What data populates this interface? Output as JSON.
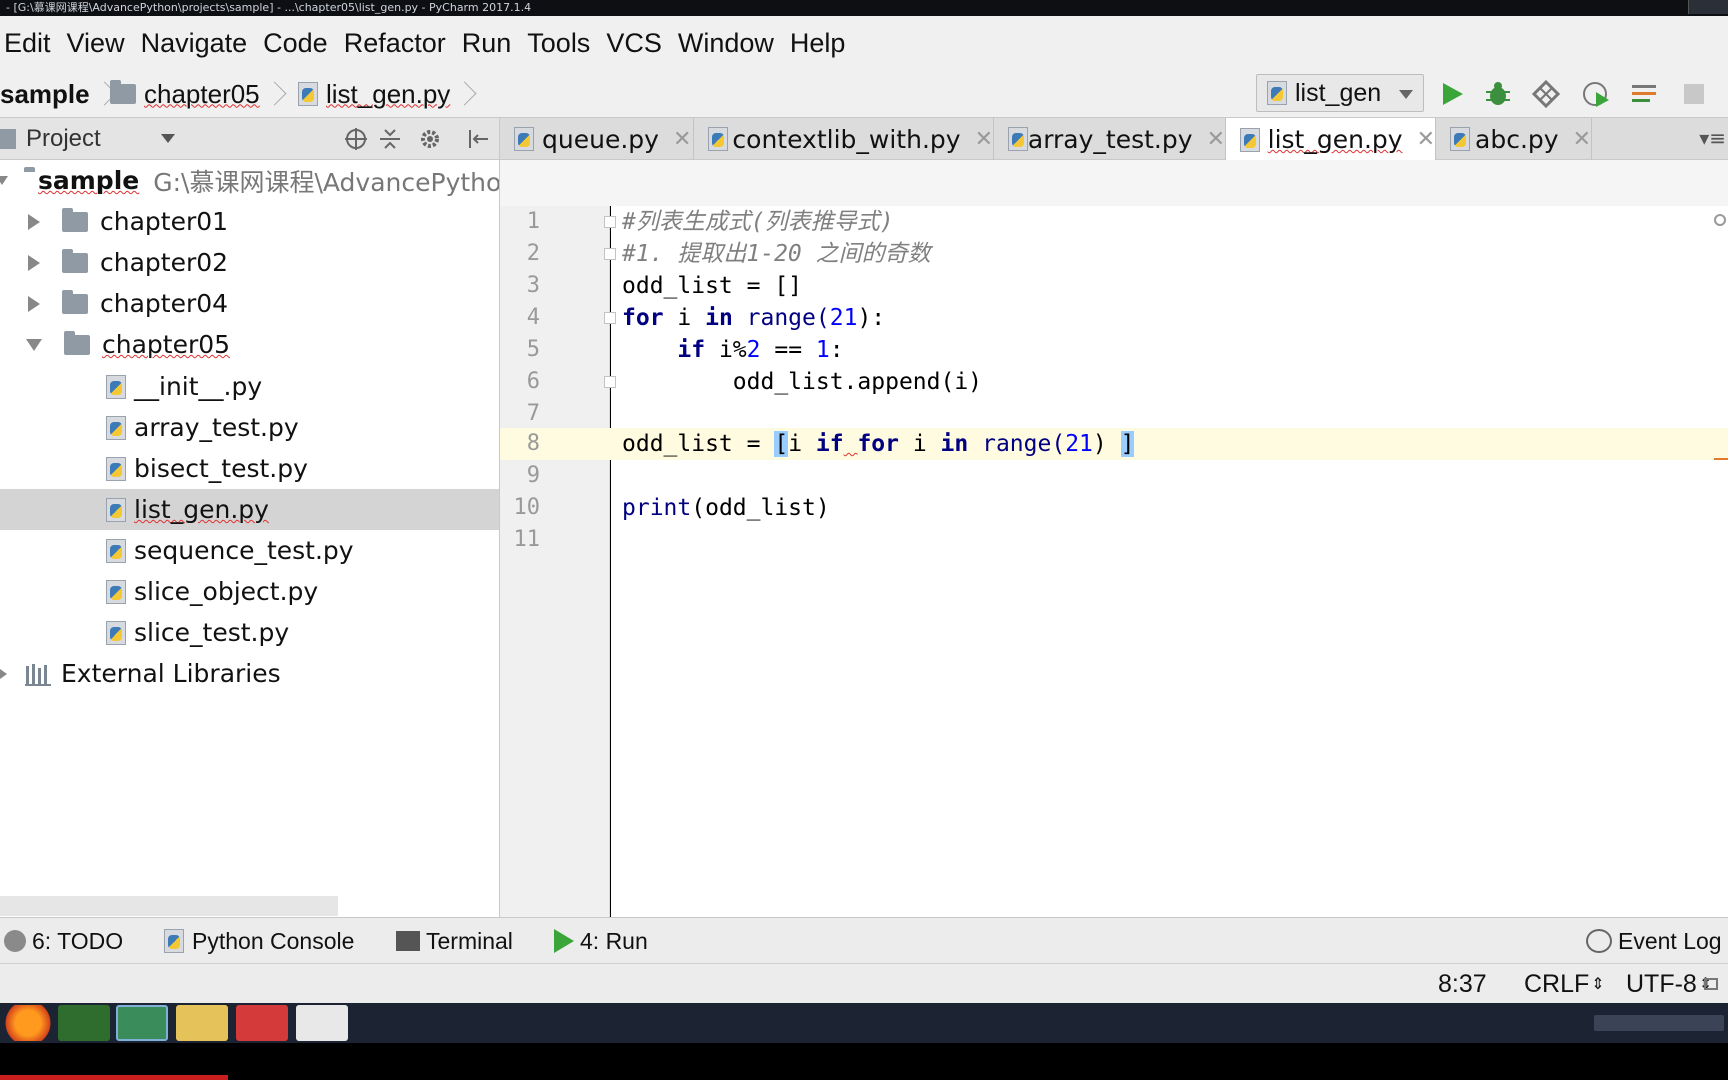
{
  "window": {
    "title": "- [G:\\慕课网课程\\AdvancePython\\projects\\sample] - ...\\chapter05\\list_gen.py - PyCharm 2017.1.4"
  },
  "menu": [
    "Edit",
    "View",
    "Navigate",
    "Code",
    "Refactor",
    "Run",
    "Tools",
    "VCS",
    "Window",
    "Help"
  ],
  "breadcrumb": {
    "project": "sample",
    "folder": "chapter05",
    "file": "list_gen.py"
  },
  "run_config": {
    "selected": "list_gen"
  },
  "toolbar_icons": [
    "run-icon",
    "debug-icon",
    "coverage-icon",
    "profile-icon",
    "concurrency-icon",
    "stop-icon"
  ],
  "project_panel": {
    "title": "Project",
    "root": {
      "name": "sample",
      "path": "G:\\慕课网课程\\AdvancePytho"
    },
    "folders": [
      "chapter01",
      "chapter02",
      "chapter04",
      "chapter05"
    ],
    "files": [
      "__init__.py",
      "array_test.py",
      "bisect_test.py",
      "list_gen.py",
      "sequence_test.py",
      "slice_object.py",
      "slice_test.py"
    ],
    "selected_file": "list_gen.py",
    "external": "External Libraries"
  },
  "tabs": [
    "queue.py",
    "contextlib_with.py",
    "array_test.py",
    "list_gen.py",
    "abc.py"
  ],
  "active_tab": "list_gen.py",
  "editor": {
    "line_numbers": [
      "1",
      "2",
      "3",
      "4",
      "5",
      "6",
      "7",
      "8",
      "9",
      "10",
      "11"
    ],
    "cursor_line": "8",
    "code": {
      "l1": "#列表生成式(列表推导式)",
      "l2": "#1. 提取出1-20 之间的奇数",
      "l3": "odd_list = []",
      "l4a": "for",
      "l4b": " i ",
      "l4c": "in",
      "l4d": " range(",
      "l4e": "21",
      "l4f": "):",
      "l5a": "    ",
      "l5b": "if",
      "l5c": " i%",
      "l5d": "2",
      "l5e": " == ",
      "l5f": "1",
      "l5g": ":",
      "l6": "        odd_list.append(i)",
      "l8a": "odd_list = ",
      "l8b": "[",
      "l8c": "i ",
      "l8d": "if",
      "l8e": " ",
      "l8f": "for",
      "l8g": " i ",
      "l8h": "in",
      "l8i": " range(",
      "l8j": "21",
      "l8k": ") ",
      "l8l": "]",
      "l10a": "print",
      "l10b": "(odd_list)"
    }
  },
  "tool_windows": {
    "todo": "6: TODO",
    "console": "Python Console",
    "terminal": "Terminal",
    "run": "4: Run",
    "event_log": "Event Log"
  },
  "status": {
    "position": "8:37",
    "line_sep": "CRLF",
    "encoding": "UTF-8"
  }
}
